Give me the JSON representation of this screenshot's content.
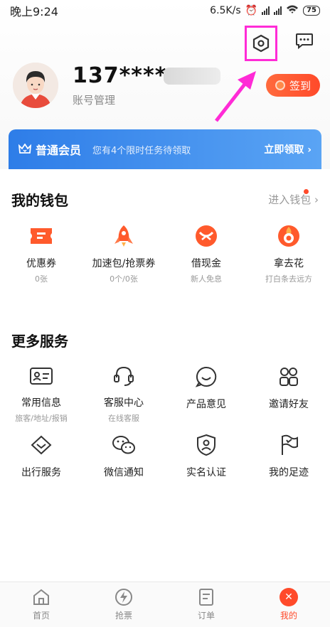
{
  "status_bar": {
    "time": "晚上9:24",
    "speed": "6.5K/s",
    "battery": "75"
  },
  "profile": {
    "phone": "137****",
    "account_manage": "账号管理",
    "checkin": "签到"
  },
  "member": {
    "title": "普通会员",
    "desc": "您有4个限时任务待领取",
    "cta": "立即领取 ›"
  },
  "wallet": {
    "title": "我的钱包",
    "link": "进入钱包 ›",
    "items": [
      {
        "label": "优惠券",
        "sub": "0张"
      },
      {
        "label": "加速包/抢票券",
        "sub": "0个/0张"
      },
      {
        "label": "借现金",
        "sub": "新人免息"
      },
      {
        "label": "拿去花",
        "sub": "打白条去远方"
      }
    ]
  },
  "services": {
    "title": "更多服务",
    "items": [
      {
        "label": "常用信息",
        "sub": "旅客/地址/报销"
      },
      {
        "label": "客服中心",
        "sub": "在线客服"
      },
      {
        "label": "产品意见",
        "sub": ""
      },
      {
        "label": "邀请好友",
        "sub": ""
      },
      {
        "label": "出行服务",
        "sub": ""
      },
      {
        "label": "微信通知",
        "sub": ""
      },
      {
        "label": "实名认证",
        "sub": ""
      },
      {
        "label": "我的足迹",
        "sub": ""
      }
    ]
  },
  "tabs": [
    {
      "label": "首页"
    },
    {
      "label": "抢票"
    },
    {
      "label": "订单"
    },
    {
      "label": "我的"
    }
  ],
  "colors": {
    "accent": "#ff4a2a",
    "member_blue": "#2e7de8",
    "highlight": "#ff2bd6"
  }
}
